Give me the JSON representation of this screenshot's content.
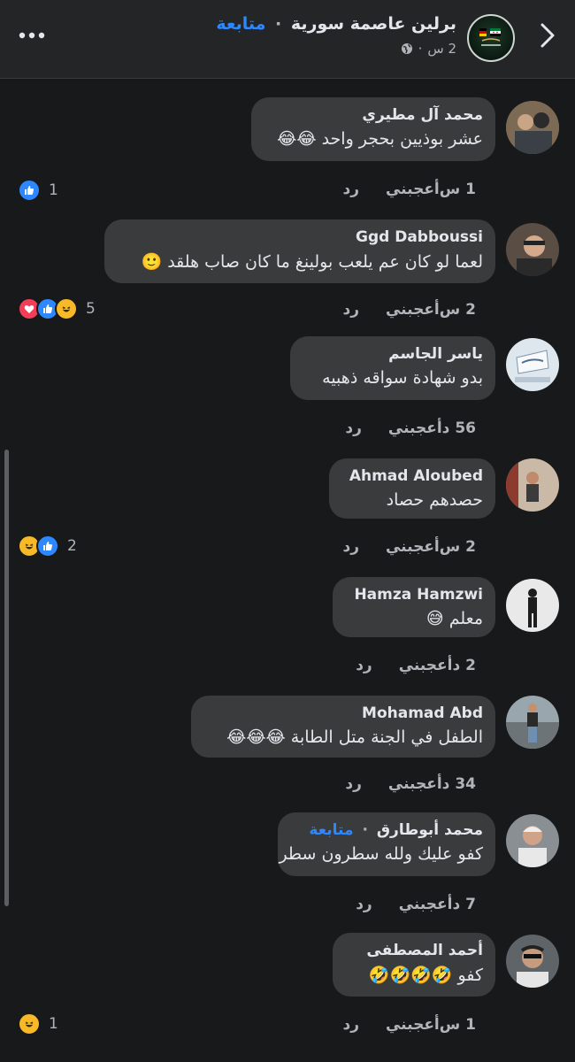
{
  "header": {
    "page_name": "برلين عاصمة سورية",
    "follow_label": "متابعة",
    "separator": "·",
    "time": "2 س",
    "privacy_icon": "globe-icon",
    "more_icon": "more-icon",
    "back_icon": "chevron-right-icon"
  },
  "comments": [
    {
      "author": "محمد آل مطيري",
      "text": "عشر بوذيين بحجر واحد 😂😂",
      "time": "1 س",
      "like_label": "أعجبني",
      "reply_label": "رد",
      "reactions": [
        "like"
      ],
      "reaction_count": "1"
    },
    {
      "author": "Ggd Dabboussi",
      "text": "لعما لو كان عم يلعب بولينغ ما كان صاب هلقد 🙂",
      "time": "2 س",
      "like_label": "أعجبني",
      "reply_label": "رد",
      "reactions": [
        "love",
        "like",
        "haha"
      ],
      "reaction_count": "5"
    },
    {
      "author": "ياسر الجاسم",
      "text": "بدو  شهادة سواقه ذهبيه",
      "time": "56 د",
      "like_label": "أعجبني",
      "reply_label": "رد",
      "reactions": [],
      "reaction_count": ""
    },
    {
      "author": "Ahmad Aloubed",
      "text": "حصدهم حصاد",
      "time": "2 س",
      "like_label": "أعجبني",
      "reply_label": "رد",
      "reactions": [
        "haha",
        "like"
      ],
      "reaction_count": "2"
    },
    {
      "author": "Hamza Hamzwi",
      "text": "معلم 😅",
      "time": "2 د",
      "like_label": "أعجبني",
      "reply_label": "رد",
      "reactions": [],
      "reaction_count": ""
    },
    {
      "author": "Mohamad Abd",
      "text": "الطفل في الجنة متل الطابة 😂😂😂",
      "time": "34 د",
      "like_label": "أعجبني",
      "reply_label": "رد",
      "reactions": [],
      "reaction_count": ""
    },
    {
      "author": "محمد أبوطارق",
      "follow_label": "متابعة",
      "text": "كفو عليك ولله سطرون سطر",
      "time": "7 د",
      "like_label": "أعجبني",
      "reply_label": "رد",
      "reactions": [],
      "reaction_count": ""
    },
    {
      "author": "أحمد المصطفى",
      "text": "كفو 🤣🤣🤣🤣",
      "time": "1 س",
      "like_label": "أعجبني",
      "reply_label": "رد",
      "reactions": [
        "haha"
      ],
      "reaction_count": "1"
    }
  ],
  "colors": {
    "background": "#18191a",
    "bubble": "#3a3b3c",
    "accent": "#2d88ff",
    "secondary_text": "#b0b3b8"
  }
}
